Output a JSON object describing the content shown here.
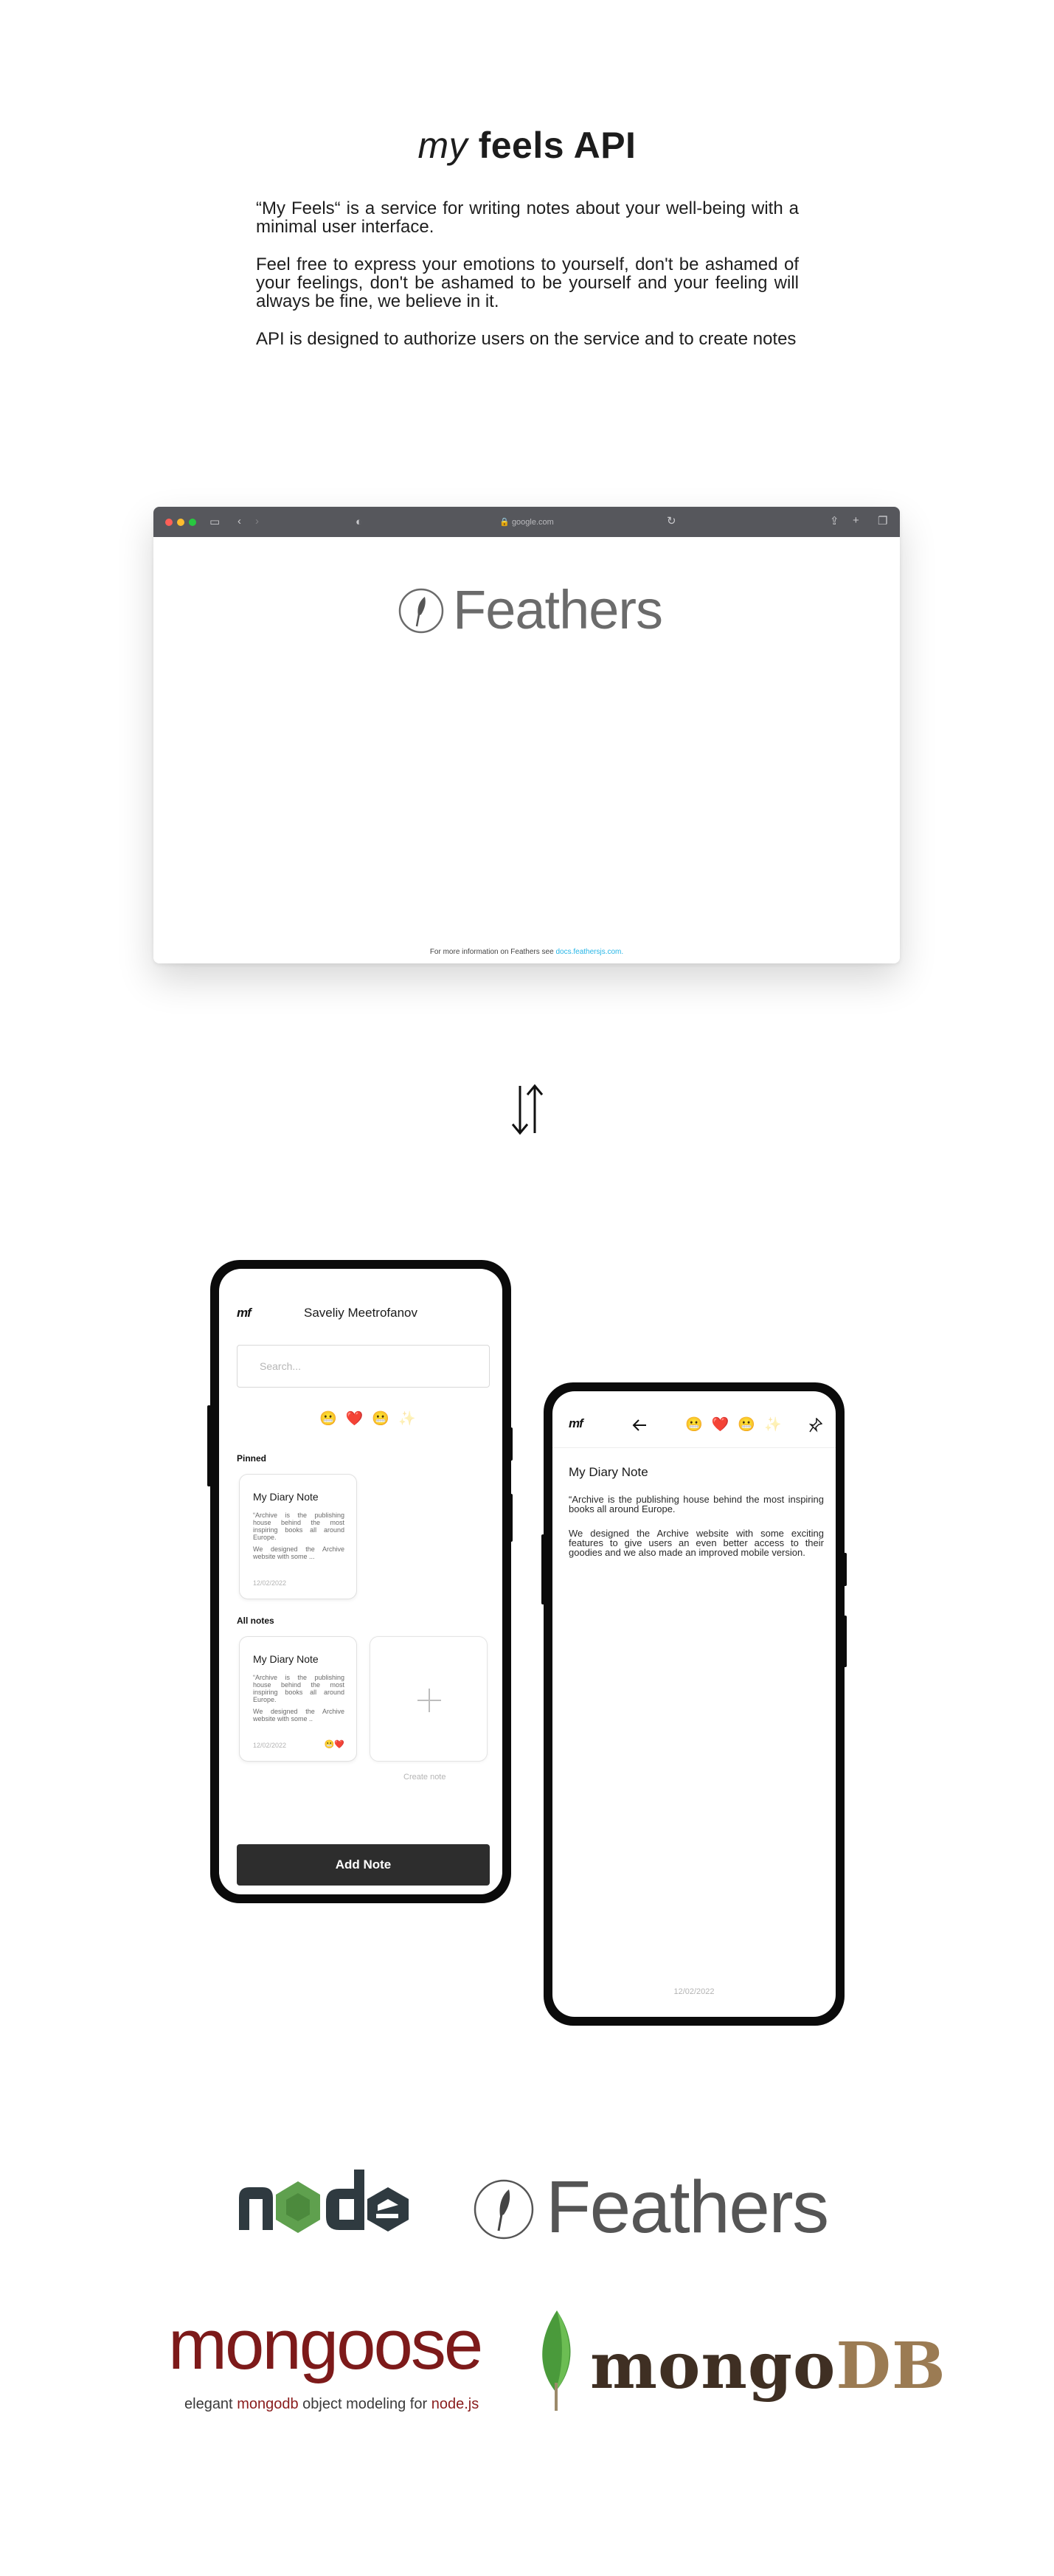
{
  "header": {
    "title_italic": "my",
    "title_bold": "feels API"
  },
  "intro": {
    "p1": "“My Feels“ is a service for writing notes about your well-being with a minimal user interface.",
    "p2": "Feel free to express your emotions to yourself, don't be ashamed of your feelings, don't be ashamed to be yourself and your feeling will always be fine, we believe in it.",
    "p3": "API is designed to authorize users on the service and to create notes"
  },
  "browser": {
    "url": "google.com",
    "logo_text": "Feathers",
    "footer_text": "For more information on Feathers see",
    "footer_link": "docs.feathersjs.com."
  },
  "phone1": {
    "logo": "mf",
    "user_name": "Saveliy Meetrofanov",
    "search_placeholder": "Search...",
    "emojis": [
      "😬",
      "❤️",
      "😬",
      "✨"
    ],
    "pinned_label": "Pinned",
    "all_notes_label": "All notes",
    "pinned_card": {
      "title": "My Diary Note",
      "text1": "“Archive is the publishing house behind the most inspiring books all around Europe.",
      "text2": "We designed the Archive website with some ...",
      "date": "12/02/2022"
    },
    "note_card": {
      "title": "My Diary Note",
      "text1": "“Archive is the publishing house behind the most inspiring books all around Europe.",
      "text2": "We designed the Archive website with some ..",
      "date": "12/02/2022",
      "emoji": "😬❤️"
    },
    "create_label": "Create note",
    "add_button": "Add Note"
  },
  "phone2": {
    "logo": "mf",
    "back_icon": "arrow-left-icon",
    "emojis": [
      "😬",
      "❤️",
      "😬",
      "✨"
    ],
    "pin_icon": "pin-icon",
    "note_title": "My Diary Note",
    "note_p1": "“Archive is the publishing house behind the most inspiring books all around Europe.",
    "note_p2": "We designed the Archive website with some exciting features to give users an even better access to their goodies and we also made an improved mobile version.",
    "date": "12/02/2022"
  },
  "logos": {
    "node": "node",
    "feathers": "Feathers",
    "mongoose": "mongoose",
    "mongoose_tagline_a": "elegant",
    "mongoose_tagline_b": "mongodb",
    "mongoose_tagline_c": "object modeling for",
    "mongoose_tagline_d": "node.js",
    "mongodb_a": "mongo",
    "mongodb_b": "DB"
  },
  "colors": {
    "browser_bar": "#56575c",
    "feathers_link": "#25b5e6",
    "node_dark": "#2f3a40",
    "node_green": "#5fa04e",
    "mongoose_red": "#7d1a1a",
    "mongodb_green": "#4a9a3b",
    "button_dark": "#2d2d2d"
  }
}
